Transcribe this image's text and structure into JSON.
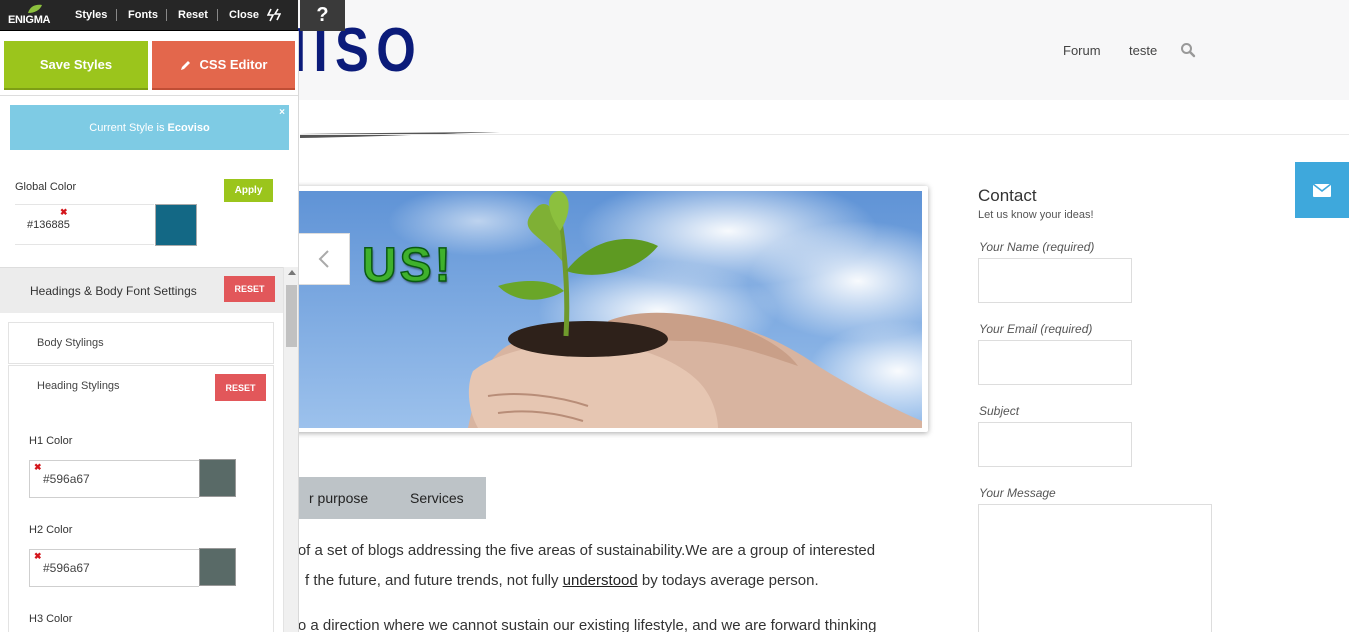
{
  "site": {
    "logo_text": "IISO",
    "nav": [
      "Forum",
      "teste"
    ],
    "search_icon": "search-icon"
  },
  "slider": {
    "caption": "US!",
    "prev_icon": "chevron-left-icon"
  },
  "tabs": [
    "r purpose",
    "Services"
  ],
  "body": {
    "line1": "ts of a set of blogs addressing the five areas of sustainability.We are a group of interested",
    "line2_pre": "f the future, and future trends, not fully ",
    "line2_link": "understood",
    "line2_post": " by todays average person.",
    "line3": " into a direction where we cannot sustain our existing lifestyle, and we are forward thinking"
  },
  "contact": {
    "title": "Contact",
    "subtitle": "Let us know your ideas!",
    "fields": [
      "Your Name (required)",
      "Your Email (required)",
      "Subject",
      "Your Message"
    ]
  },
  "enigma": {
    "logo": "ENIGMA",
    "menu": [
      "Styles",
      "Fonts",
      "Reset",
      "Close"
    ],
    "collapse_icon": "bolt-icon",
    "help": "?"
  },
  "panel": {
    "save_label": "Save Styles",
    "css_label": "CSS Editor",
    "current_prefix": "Current Style is",
    "current_name": "Ecoviso",
    "close_x": "×",
    "global_color_label": "Global Color",
    "apply_label": "Apply",
    "global_color_value": "#136885",
    "section_title": "Headings & Body Font Settings",
    "reset_label": "RESET",
    "body_stylings": "Body Stylings",
    "heading_stylings": "Heading Stylings",
    "h1_label": "H1 Color",
    "h1_value": "#596a67",
    "h2_label": "H2 Color",
    "h2_value": "#596a67",
    "h3_label": "H3 Color"
  },
  "colors": {
    "global_swatch": "#136885",
    "h_swatch": "#596a67",
    "save_green": "#9bc51c",
    "css_orange": "#e3674c",
    "info_blue": "#7ecbe4",
    "reset_red": "#e2575a",
    "mail_blue": "#3ea8dc",
    "logo_navy": "#0b1b7a"
  }
}
